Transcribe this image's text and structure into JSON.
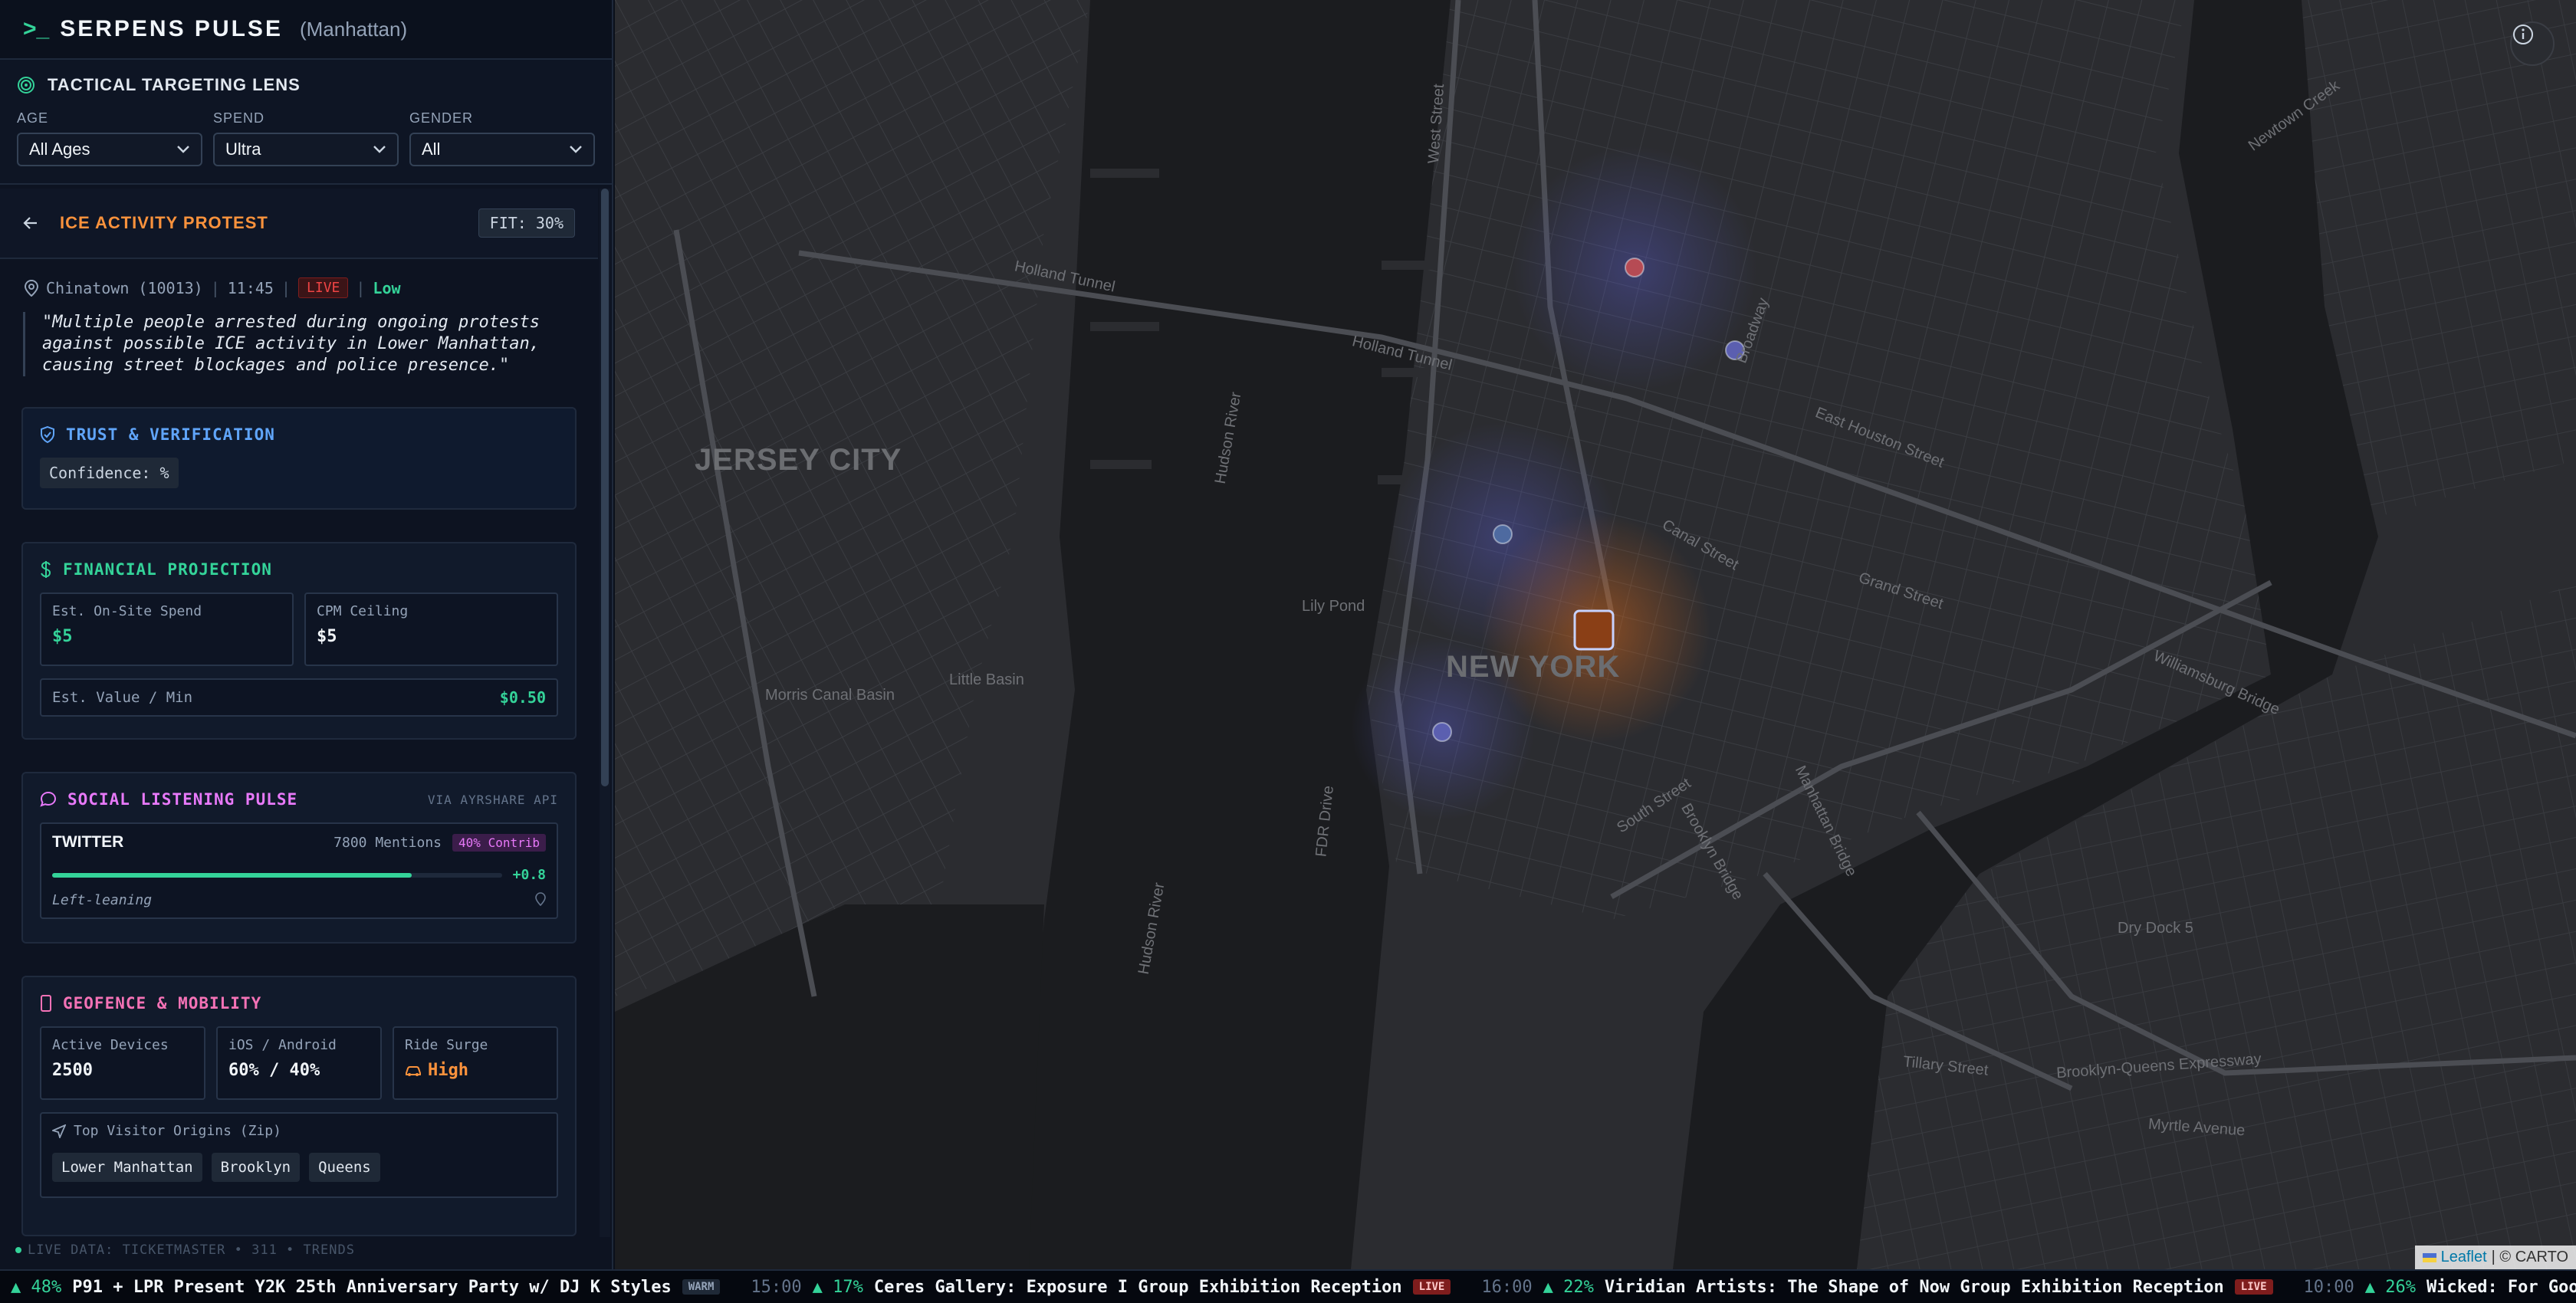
{
  "header": {
    "prompt": ">_",
    "brand": "SERPENS PULSE",
    "region": "(Manhattan)"
  },
  "lens": {
    "title": "TACTICAL TARGETING LENS",
    "filters": [
      {
        "label": "AGE",
        "value": "All Ages"
      },
      {
        "label": "SPEND",
        "value": "Ultra"
      },
      {
        "label": "GENDER",
        "value": "All"
      }
    ]
  },
  "event": {
    "title": "ICE ACTIVITY PROTEST",
    "fit": "FIT: 30%",
    "location": "Chinatown (10013)",
    "time": "11:45",
    "status": "LIVE",
    "level": "Low",
    "quote": "\"Multiple people arrested during ongoing protests against possible ICE activity in Lower Manhattan, causing street blockages and police presence.\""
  },
  "trust": {
    "title": "TRUST & VERIFICATION",
    "confidence": "Confidence: %"
  },
  "financial": {
    "title": "FINANCIAL PROJECTION",
    "onsite_label": "Est. On-Site Spend",
    "onsite_value": "$5",
    "cpm_label": "CPM Ceiling",
    "cpm_value": "$5",
    "value_label": "Est. Value / Min",
    "value_value": "$0.50"
  },
  "social": {
    "title": "SOCIAL LISTENING PULSE",
    "via": "VIA AYRSHARE API",
    "platform": "TWITTER",
    "mentions": "7800 Mentions",
    "contrib": "40% Contrib",
    "sentiment_fill": 0.8,
    "score": "+0.8",
    "leaning": "Left-leaning"
  },
  "geo": {
    "title": "GEOFENCE & MOBILITY",
    "devices_label": "Active Devices",
    "devices_value": "2500",
    "os_label": "iOS / Android",
    "os_value": "60% / 40%",
    "surge_label": "Ride Surge",
    "surge_value": "High",
    "origins_label": "Top Visitor Origins (Zip)",
    "origins": [
      "Lower Manhattan",
      "Brooklyn",
      "Queens"
    ]
  },
  "status_line": "LIVE   DATA: TICKETMASTER • 311 • TRENDS",
  "map": {
    "labels": {
      "jersey_city": "JERSEY CITY",
      "new_york": "NEW YORK",
      "holland_tunnel": "Holland Tunnel",
      "holland_tunnel2": "Holland Tunnel",
      "hudson_river": "Hudson River",
      "hudson_river2": "Hudson River",
      "west_street": "West Street",
      "fdr_drive": "FDR Drive",
      "canal_street": "Canal Street",
      "broadway": "Broadway",
      "houston": "East Houston Street",
      "williamsburg": "Williamsburg Bridge",
      "manhattan_bridge": "Manhattan Bridge",
      "brooklyn_bridge": "Brooklyn Bridge",
      "bqe": "Brooklyn-Queens Expressway",
      "grand": "Grand Street",
      "newtown": "Newtown Creek",
      "south_st": "South Street",
      "tillary": "Tillary Street",
      "myrtle": "Myrtle Avenue",
      "lily_pond": "Lily Pond",
      "little_basin": "Little Basin",
      "morris_canal": "Morris Canal Basin",
      "dry_dock": "Dry Dock 5"
    },
    "attribution_link": "Leaflet",
    "attribution_text": "| © CARTO"
  },
  "ticker": [
    {
      "time": "",
      "pct": "▲ 48%",
      "name": "P91 + LPR Present Y2K 25th Anniversary Party w/ DJ K Styles",
      "badge": "WARM"
    },
    {
      "time": "15:00",
      "pct": "▲ 17%",
      "name": "Ceres Gallery: Exposure I Group Exhibition Reception",
      "badge": "LIVE"
    },
    {
      "time": "16:00",
      "pct": "▲ 22%",
      "name": "Viridian Artists: The Shape of Now Group Exhibition Reception",
      "badge": "LIVE"
    },
    {
      "time": "10:00",
      "pct": "▲ 26%",
      "name": "Wicked: For Good The Soundtrack",
      "badge": ""
    }
  ],
  "colors": {
    "accent_green": "#34d399",
    "accent_orange": "#fb923c",
    "live_red": "#ef4444"
  }
}
